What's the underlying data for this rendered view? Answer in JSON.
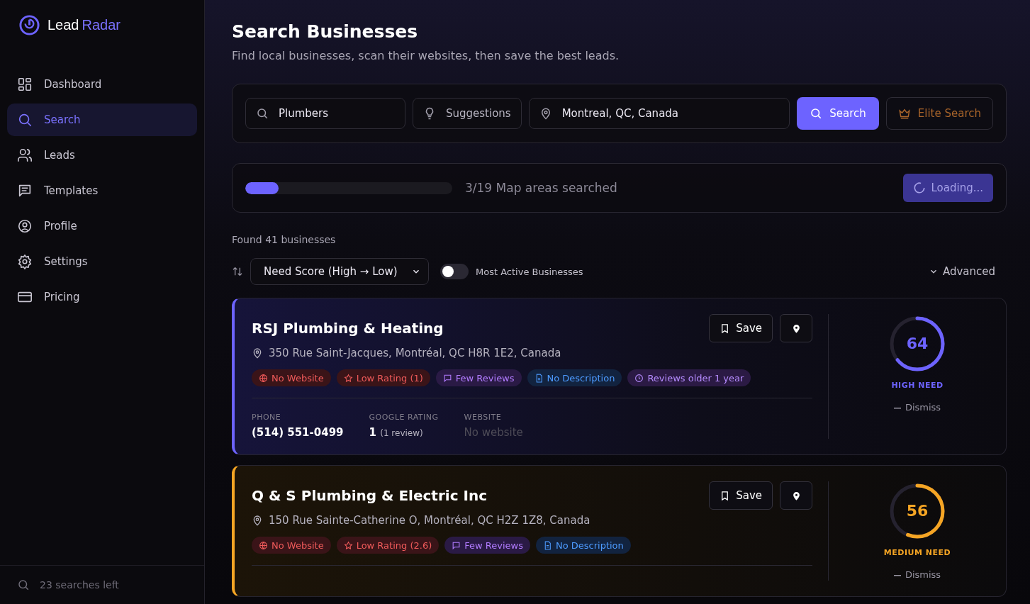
{
  "brand": {
    "first": "Lead",
    "second": "Radar"
  },
  "nav": [
    {
      "label": "Dashboard",
      "selected": false
    },
    {
      "label": "Search",
      "selected": true
    },
    {
      "label": "Leads",
      "selected": false
    },
    {
      "label": "Templates",
      "selected": false
    },
    {
      "label": "Profile",
      "selected": false
    },
    {
      "label": "Settings",
      "selected": false
    },
    {
      "label": "Pricing",
      "selected": false
    }
  ],
  "searches_left": "23 searches left",
  "header": {
    "title": "Search Businesses",
    "subtitle": "Find local businesses, scan their websites, then save the best leads."
  },
  "search_bar": {
    "query": "Plumbers",
    "suggestions": "Suggestions",
    "location": "Montreal, QC, Canada",
    "search": "Search",
    "elite": "Elite Search"
  },
  "progress": {
    "level": 0.16,
    "label": "3/19 Map areas searched",
    "button": "Loading..."
  },
  "found": "Found 41 businesses",
  "sort": {
    "value": "Need Score (High → Low)",
    "toggle_label": "Most Active Businesses",
    "on": false,
    "advanced": "Advanced"
  },
  "results": [
    {
      "name": "RSJ Plumbing & Heating",
      "address": "350 Rue Saint-Jacques, Montréal, QC H8R 1E2, Canada",
      "kind": "high",
      "score": "64",
      "need_label": "HIGH NEED",
      "dismiss": "Dismiss",
      "save": "Save",
      "tags": [
        {
          "kind": "website",
          "label": "No Website"
        },
        {
          "kind": "rating",
          "label": "Low Rating (1)"
        },
        {
          "kind": "reviews",
          "label": "Few Reviews"
        },
        {
          "kind": "description",
          "label": "No Description"
        },
        {
          "kind": "age",
          "label": "Reviews older 1 year"
        }
      ],
      "details": [
        {
          "kind": "phone",
          "label": "PHONE",
          "value": "(514) 551-0499"
        },
        {
          "kind": "rating",
          "label": "GOOGLE RATING",
          "value": "1",
          "note": "(1 review)"
        },
        {
          "kind": "missing",
          "label": "WEBSITE",
          "value": "No website"
        }
      ]
    },
    {
      "name": "Q & S Plumbing & Electric Inc",
      "address": "150 Rue Sainte-Catherine O, Montréal, QC H2Z 1Z8, Canada",
      "kind": "medium",
      "score": "56",
      "need_label": "MEDIUM NEED",
      "dismiss": "Dismiss",
      "save": "Save",
      "tags": [
        {
          "kind": "website",
          "label": "No Website"
        },
        {
          "kind": "rating",
          "label": "Low Rating (2.6)"
        },
        {
          "kind": "reviews",
          "label": "Few Reviews"
        },
        {
          "kind": "description",
          "label": "No Description"
        }
      ]
    }
  ]
}
